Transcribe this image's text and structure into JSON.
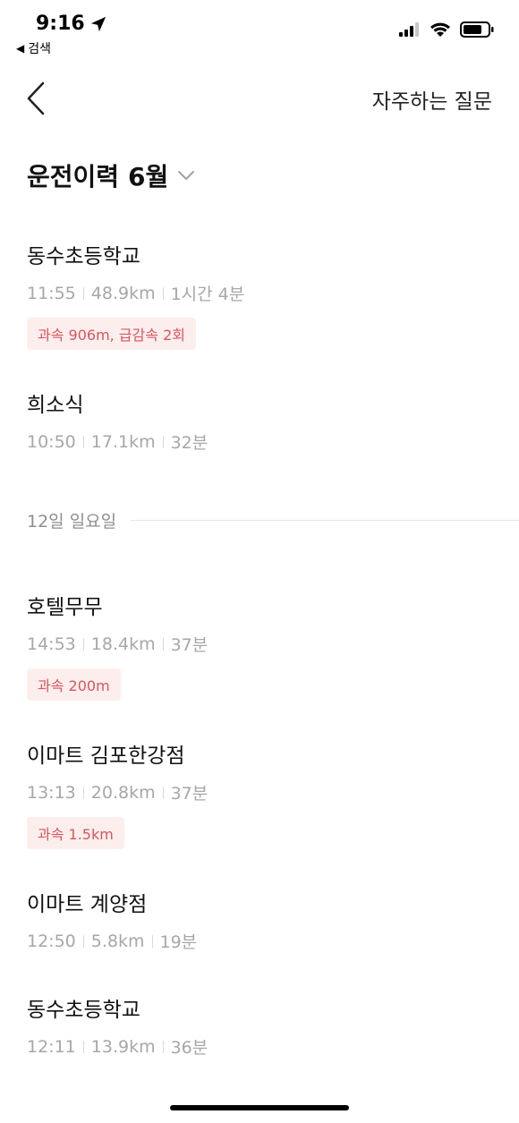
{
  "status_bar": {
    "time": "9:16",
    "back_app_label": "검색",
    "icons": [
      "location-arrow-icon",
      "cellular-signal-icon",
      "wifi-icon",
      "battery-icon"
    ]
  },
  "nav": {
    "faq_label": "자주하는 질문"
  },
  "header": {
    "title": "운전이력",
    "month": "6월"
  },
  "trips_top": [
    {
      "name": "동수초등학교",
      "time": "11:55",
      "distance": "48.9km",
      "duration": "1시간 4분",
      "badge": "과속 906m, 급감속 2회"
    },
    {
      "name": "희소식",
      "time": "10:50",
      "distance": "17.1km",
      "duration": "32분",
      "badge": ""
    }
  ],
  "section_label": "12일 일요일",
  "trips_section": [
    {
      "name": "호텔무무",
      "time": "14:53",
      "distance": "18.4km",
      "duration": "37분",
      "badge": "과속 200m"
    },
    {
      "name": "이마트 김포한강점",
      "time": "13:13",
      "distance": "20.8km",
      "duration": "37분",
      "badge": "과속 1.5km"
    },
    {
      "name": "이마트 계양점",
      "time": "12:50",
      "distance": "5.8km",
      "duration": "19분",
      "badge": ""
    },
    {
      "name": "동수초등학교",
      "time": "12:11",
      "distance": "13.9km",
      "duration": "36분",
      "badge": ""
    }
  ],
  "colors": {
    "badge_bg": "#fdeeee",
    "badge_text": "#d6575c",
    "meta_text": "#a7a7a7"
  }
}
